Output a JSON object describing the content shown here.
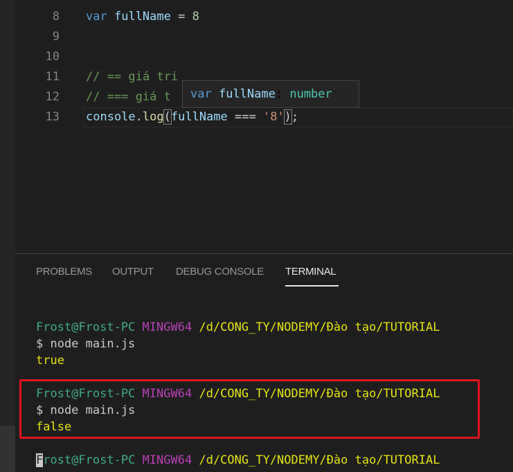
{
  "editor": {
    "lines": [
      {
        "n": "8",
        "kw": "var",
        "name": "fullName",
        "op": " = ",
        "val": "8"
      },
      {
        "n": "9"
      },
      {
        "n": "10"
      },
      {
        "n": "11",
        "comment": "// == giá tri"
      },
      {
        "n": "12",
        "comment": "// === giá t"
      },
      {
        "n": "13",
        "obj": "console",
        "dot": ".",
        "fn": "log",
        "open": "(",
        "arg": "fullName",
        "op": " === ",
        "str": "'8'",
        "close": ")",
        "end": ";"
      }
    ],
    "hover": {
      "kw": "var",
      "name": "fullName",
      "colon": ": ",
      "type": "number"
    }
  },
  "panel": {
    "tabs": [
      "PROBLEMS",
      "OUTPUT",
      "DEBUG CONSOLE",
      "TERMINAL"
    ],
    "active": "TERMINAL"
  },
  "terminal": {
    "user": "Frost@Frost-PC",
    "host": "MINGW64",
    "path": "/d/CONG_TY/NODEMY/Đào tạo/TUTORIAL",
    "cursor_char": "F",
    "user_rest": "rost@Frost-PC",
    "cmd": "$ node main.js",
    "outputs": [
      "true",
      "false"
    ]
  },
  "colors": {
    "highlight": "#e0141a"
  }
}
